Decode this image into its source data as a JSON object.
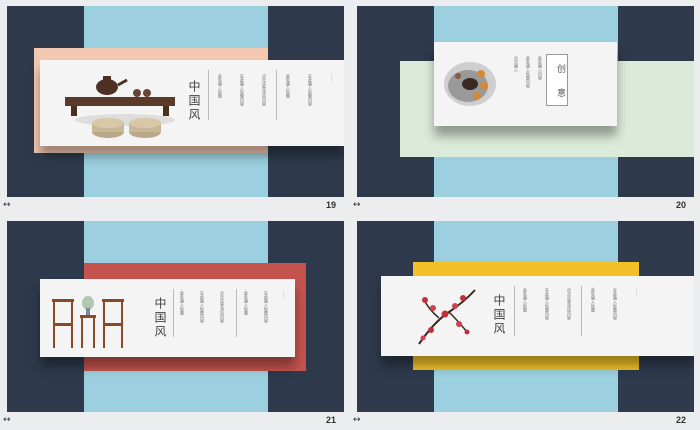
{
  "slides": [
    {
      "number": "19",
      "footer_icon": "↔",
      "title": "中国风",
      "texts": [
        "此处输入标题",
        "在此输入标题内容",
        "点击这里添加内容"
      ],
      "dots": "……"
    },
    {
      "number": "20",
      "footer_icon": "↔",
      "title": "创意",
      "texts": [
        "点击输入",
        "此处输入标题内容",
        "此处输入内容"
      ],
      "box_label": "创 意"
    },
    {
      "number": "21",
      "footer_icon": "↔",
      "title": "中国风",
      "texts": [
        "此处输入标题",
        "在此输入标题内容",
        "点击这里添加内容"
      ],
      "dots": "……"
    },
    {
      "number": "22",
      "footer_icon": "↔",
      "title": "中国风",
      "texts": [
        "此处输入标题",
        "在此输入标题内容",
        "点击这里添加内容"
      ],
      "dots": "……"
    }
  ],
  "colors": {
    "navy": "#2e3a4c",
    "sky": "#9ccfdf",
    "peach": "#f2c8b0",
    "mint": "#dcebd9",
    "red": "#c4534e",
    "yellow": "#f2c12a"
  }
}
